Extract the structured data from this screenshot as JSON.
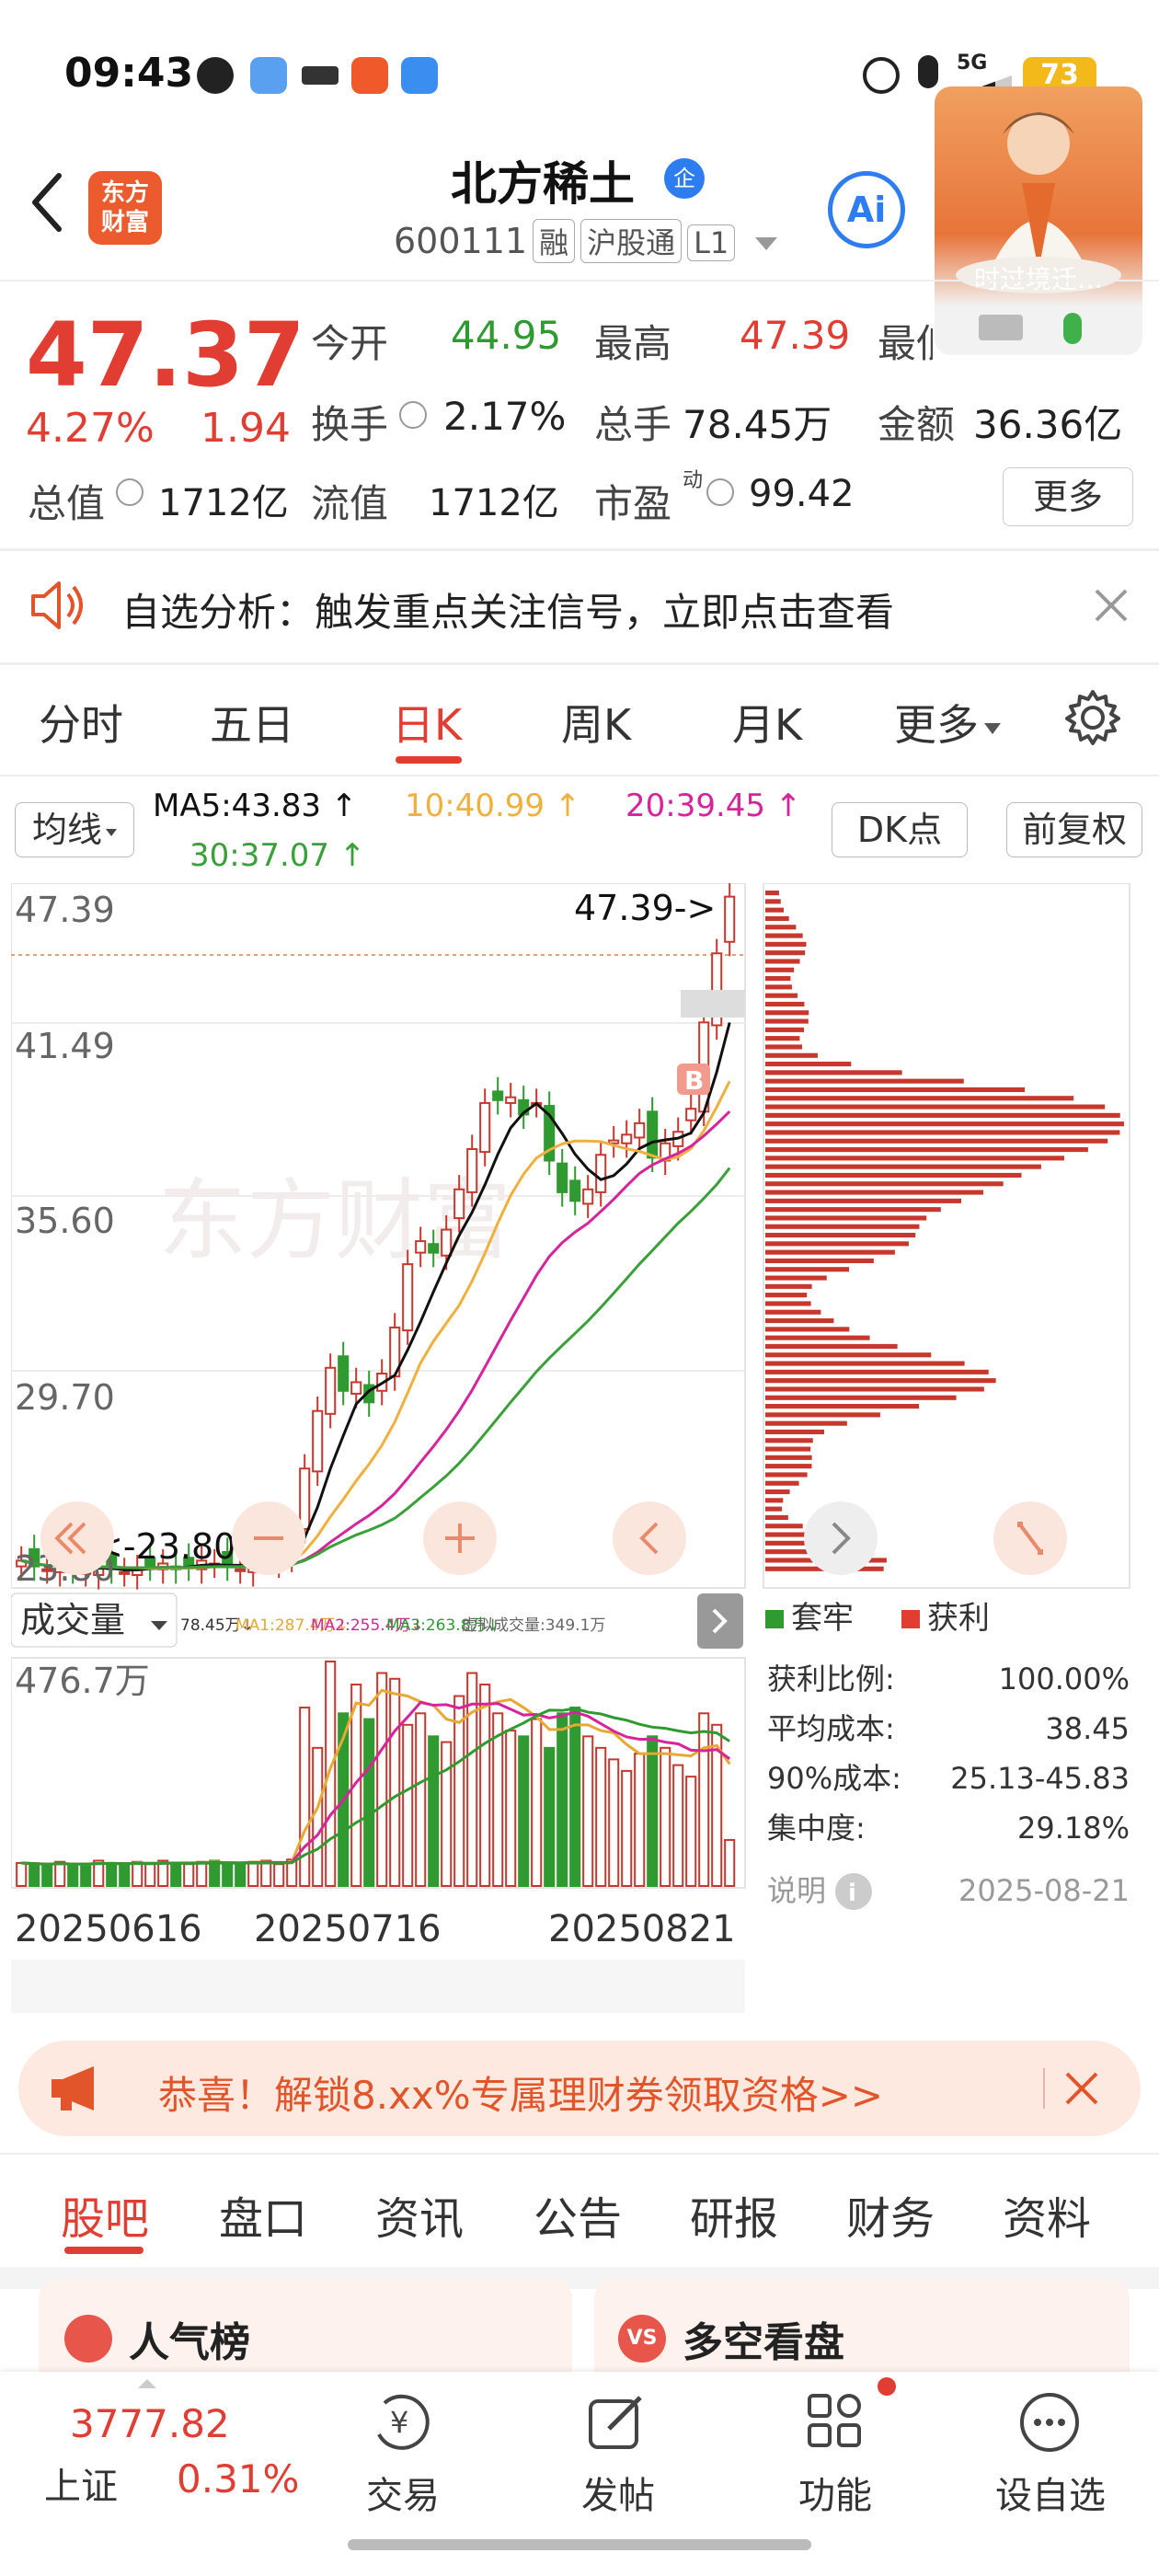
{
  "status": {
    "time": "09:43",
    "signal": "5G",
    "battery": "73"
  },
  "header": {
    "logo_line1": "东方",
    "logo_line2": "财富",
    "stock_name": "北方稀土",
    "stock_code": "600111",
    "tags": [
      "融",
      "沪股通",
      "L1"
    ],
    "badge": "企",
    "ai_label": "Ai",
    "video_caption": "时过境迁…"
  },
  "quote": {
    "price": "47.37",
    "change_pct": "4.27%",
    "change": "1.94",
    "open_label": "今开",
    "open": "44.95",
    "high_label": "最高",
    "high": "47.39",
    "low_label": "最低",
    "turnover_label": "换手",
    "turnover": "2.17%",
    "volume_label": "总手",
    "volume": "78.45万",
    "amount_label": "金额",
    "amount": "36.36亿",
    "mktcap_label": "总值",
    "mktcap": "1712亿",
    "float_label": "流值",
    "float_cap": "1712亿",
    "pe_label": "市盈",
    "pe_sup": "动",
    "pe": "99.42",
    "more": "更多"
  },
  "notice": {
    "text": "自选分析：触发重点关注信号，立即点击查看"
  },
  "tabs": [
    "分时",
    "五日",
    "日K",
    "周K",
    "月K",
    "更多"
  ],
  "active_tab": "日K",
  "ma_row": {
    "ma_button": "均线",
    "ma5": "MA5:43.83 ↑",
    "ma10": "10:40.99 ↑",
    "ma20": "20:39.45 ↑",
    "ma30": "30:37.07 ↑",
    "dk_button": "DK点",
    "adjust_button": "前复权"
  },
  "chart_data": {
    "type": "candlestick",
    "y_ticks": [
      "47.39",
      "41.49",
      "35.60",
      "29.70",
      "23.80"
    ],
    "ylim": [
      23.8,
      47.39
    ],
    "high_marker": "47.39->",
    "low_marker": "<-23.80",
    "buy_marker": "B",
    "watermark": "东方财富",
    "colors": {
      "up": "#c8372d",
      "down": "#2f9a2f",
      "ma5": "#111111",
      "ma10": "#f0b040",
      "ma20": "#d6249a",
      "ma30": "#3aa03a"
    },
    "closes": [
      24.3,
      24.1,
      24.0,
      24.2,
      24.0,
      23.9,
      24.1,
      24.0,
      23.9,
      24.0,
      24.1,
      24.2,
      24.0,
      24.1,
      24.3,
      24.2,
      24.1,
      24.0,
      24.2,
      24.3,
      24.5,
      25.0,
      27.5,
      29.5,
      31.0,
      30.2,
      30.5,
      29.8,
      30.8,
      32.4,
      34.6,
      35.4,
      35.0,
      35.8,
      37.2,
      38.6,
      40.2,
      40.3,
      40.4,
      39.8,
      40.2,
      38.2,
      37.1,
      36.8,
      37.2,
      38.4,
      38.9,
      39.1,
      39.5,
      38.3,
      38.8,
      39.2,
      40.0,
      43.0,
      45.4,
      47.37
    ],
    "volume": {
      "label": "成交量",
      "ticker_vol": "78.45万↓",
      "ma1": "MA1:287.4万↓",
      "ma2": "MA2:255.4万↓",
      "ma3": "MA3:263.8万↓",
      "virtual": "虚拟成交量:349.1万",
      "max_label": "476.7万",
      "values": [
        40,
        38,
        36,
        42,
        35,
        38,
        44,
        40,
        36,
        42,
        38,
        44,
        40,
        38,
        42,
        44,
        40,
        38,
        42,
        44,
        38,
        46,
        310,
        240,
        390,
        300,
        350,
        290,
        370,
        360,
        280,
        300,
        260,
        250,
        330,
        370,
        350,
        300,
        270,
        260,
        290,
        240,
        300,
        310,
        260,
        240,
        220,
        200,
        230,
        260,
        240,
        210,
        190,
        300,
        280,
        80
      ],
      "x_ticks": [
        "20250616",
        "20250716",
        "20250821"
      ]
    },
    "distribution": {
      "legend_hold": "套牢",
      "legend_profit": "获利",
      "profit_ratio_label": "获利比例:",
      "profit_ratio": "100.00%",
      "avg_cost_label": "平均成本:",
      "avg_cost": "38.45",
      "cost90_label": "90%成本:",
      "cost90": "25.13-45.83",
      "concentration_label": "集中度:",
      "concentration": "29.18%",
      "note_label": "说明",
      "date": "2025-08-21"
    }
  },
  "banner": {
    "text": "恭喜！解锁8.xx%专属理财券领取资格>>"
  },
  "bottom_tabs": [
    "股吧",
    "盘口",
    "资讯",
    "公告",
    "研报",
    "财务",
    "资料"
  ],
  "cards": [
    "人气榜",
    "多空看盘"
  ],
  "nav": {
    "index_value": "3777.82",
    "index_name": "上证",
    "index_change": "0.31%",
    "items": [
      "交易",
      "发帖",
      "功能",
      "设自选"
    ]
  }
}
